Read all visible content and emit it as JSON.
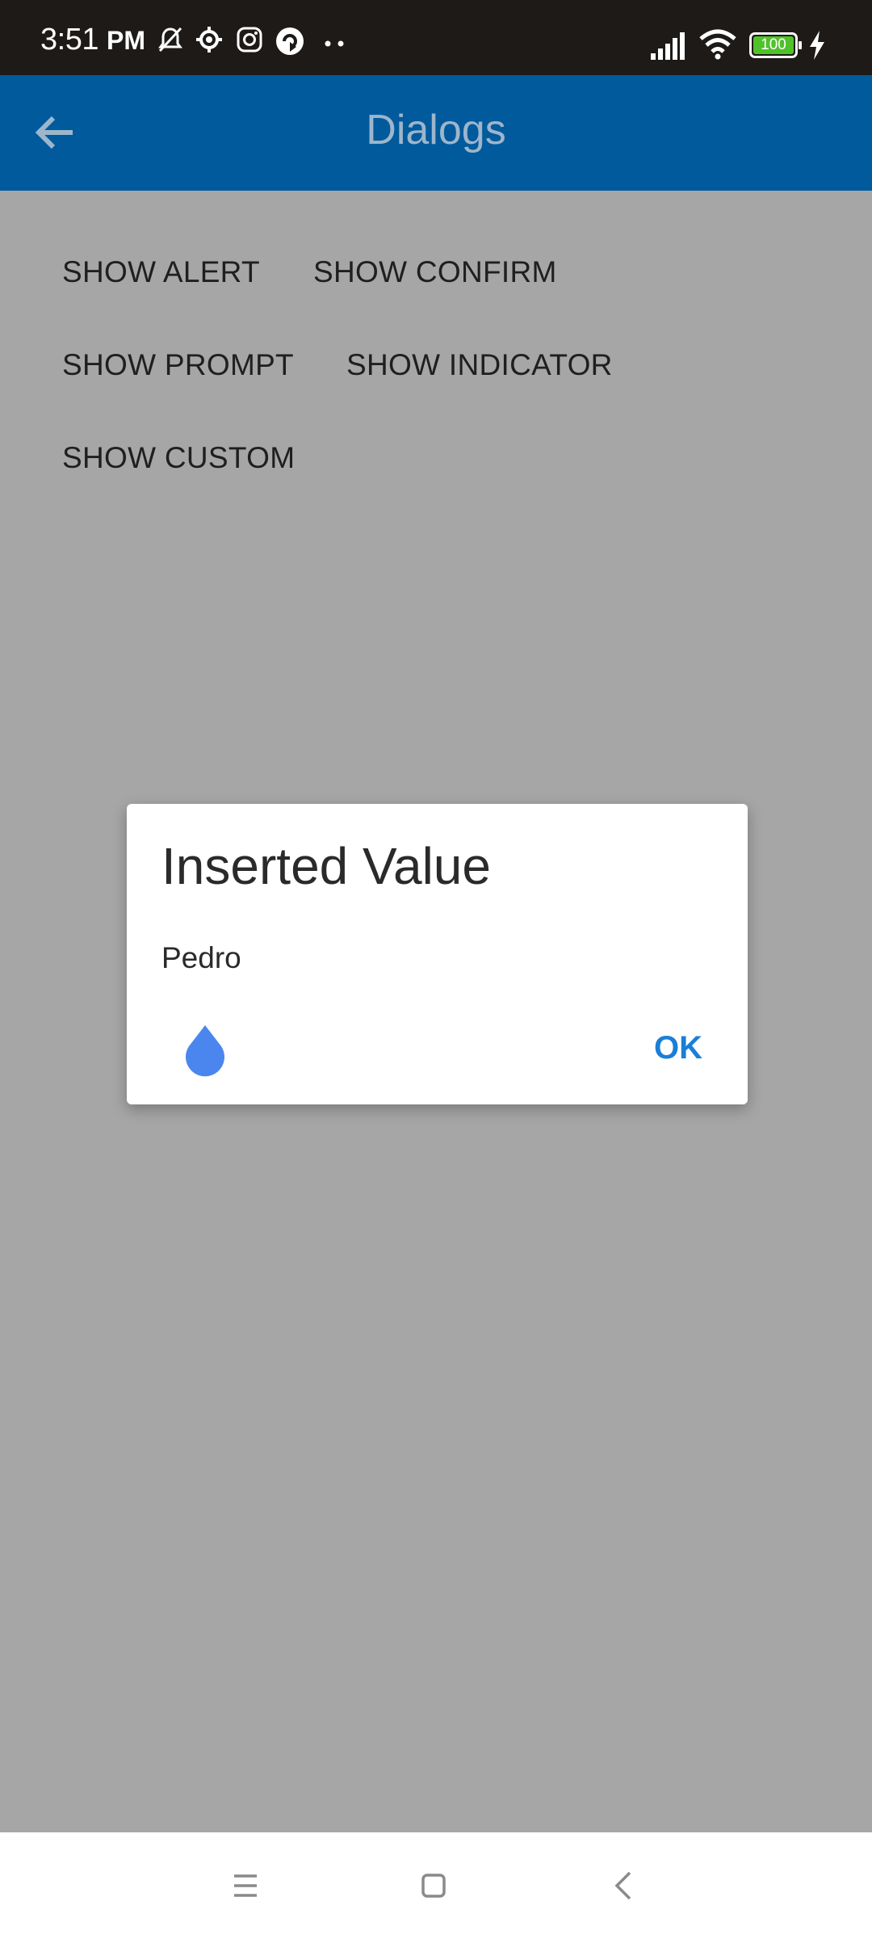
{
  "status_bar": {
    "time": "3:51",
    "ampm": "PM",
    "battery": "100",
    "icons": [
      "bell-off-icon",
      "settings-icon",
      "instagram-icon",
      "vpn-icon",
      "more-dots-icon",
      "signal-icon",
      "wifi-icon",
      "battery-icon",
      "charging-icon"
    ]
  },
  "app_bar": {
    "title": "Dialogs",
    "color": "#005a9c"
  },
  "buttons": {
    "show_alert": "SHOW ALERT",
    "show_confirm": "SHOW CONFIRM",
    "show_prompt": "SHOW PROMPT",
    "show_indicator": "SHOW INDICATOR",
    "show_custom": "SHOW CUSTOM"
  },
  "dialog": {
    "title": "Inserted Value",
    "message": "Pedro",
    "icon": "water-drop-icon",
    "ok_label": "OK",
    "accent": "#1a7fd8"
  },
  "nav_bar": {
    "icons": [
      "menu-icon",
      "home-icon",
      "back-icon"
    ]
  }
}
